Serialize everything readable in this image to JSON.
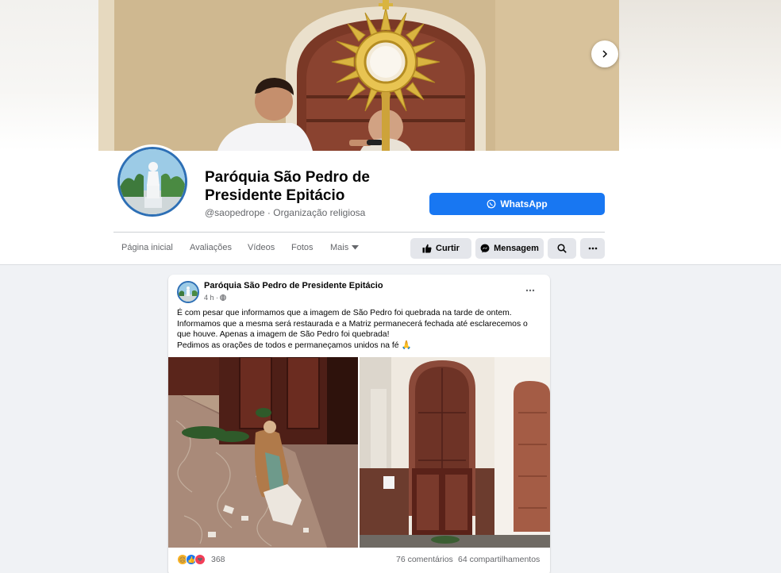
{
  "page": {
    "name": "Paróquia São Pedro de Presidente Epitácio",
    "handle": "@saopedrope",
    "separator": "·",
    "category": "Organização religiosa",
    "whatsapp_label": "WhatsApp"
  },
  "nav": {
    "tabs": [
      {
        "label": "Página inicial"
      },
      {
        "label": "Avaliações"
      },
      {
        "label": "Vídeos"
      },
      {
        "label": "Fotos"
      },
      {
        "label": "Mais"
      }
    ],
    "actions": {
      "like_label": "Curtir",
      "message_label": "Mensagem"
    }
  },
  "post": {
    "author": "Paróquia São Pedro de Presidente Epitácio",
    "time": "4 h ·",
    "lines": [
      "É com pesar que informamos que a imagem de São Pedro foi quebrada na tarde de ontem.",
      "Informamos que a mesma será restaurada e a Matriz permanecerá fechada até esclarecemos o",
      "que houve. Apenas a imagem de São Pedro foi quebrada!",
      "Pedimos as orações de todos e permaneçamos unidos na fé 🙏"
    ],
    "reaction_count": "368",
    "comments": "76 comentários",
    "shares": "64 compartilhamentos"
  },
  "icons": {
    "next": "chevron-right-icon",
    "whatsapp": "whatsapp-icon",
    "like": "thumbs-up-icon",
    "messenger": "messenger-icon",
    "search": "search-icon",
    "more": "more-dots-icon",
    "caret": "caret-down-icon",
    "globe": "globe-icon"
  },
  "colors": {
    "brand_blue": "#1877f2",
    "secondary_button": "#e4e6eb",
    "muted_text": "#65676b",
    "background": "#f0f2f5"
  }
}
